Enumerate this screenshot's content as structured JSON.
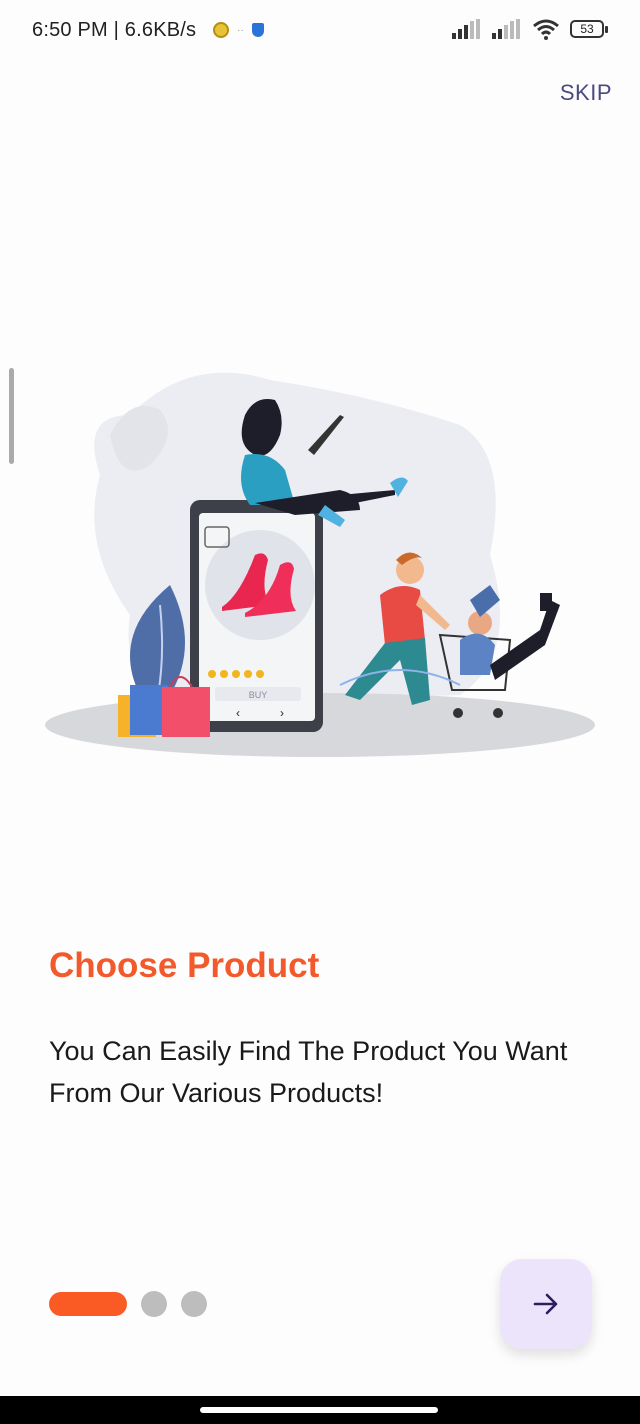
{
  "status_bar": {
    "time_speed": "6:50 PM | 6.6KB/s",
    "battery": "53"
  },
  "header": {
    "skip_label": "SKIP"
  },
  "onboarding": {
    "title": "Choose Product",
    "description": "You Can Easily Find The Product You Want From Our Various Products!",
    "illustration_buy_label": "BUY",
    "page_indicator": {
      "current": 1,
      "total": 3
    }
  },
  "colors": {
    "accent": "#f25a2b",
    "active_dot": "#fa5b25",
    "inactive_dot": "#bdbdbd",
    "next_button_bg": "#ece4fb",
    "icon": "#2a1f5e"
  },
  "icons": {
    "next": "arrow-right-icon"
  }
}
